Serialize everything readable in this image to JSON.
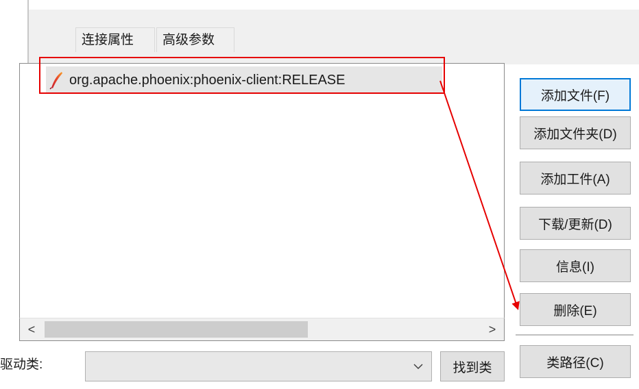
{
  "tabs": [
    {
      "label": "连接属性"
    },
    {
      "label": "高级参数"
    }
  ],
  "libraries": [
    {
      "name": "org.apache.phoenix:phoenix-client:RELEASE",
      "icon": "feather-icon"
    }
  ],
  "buttons": {
    "add_file": "添加文件(F)",
    "add_folder": "添加文件夹(D)",
    "add_artifact": "添加工件(A)",
    "download_update": "下载/更新(D)",
    "info": "信息(I)",
    "delete": "删除(E)",
    "classpath": "类路径(C)",
    "find_class": "找到类"
  },
  "driver": {
    "label": "驱动类:",
    "selected_value": ""
  },
  "scrollbar": {
    "left_arrow": "<",
    "right_arrow": ">"
  },
  "colors": {
    "annotation": "#e60000",
    "primary_border": "#0078d7",
    "selection_bg": "#e6e6e6"
  }
}
